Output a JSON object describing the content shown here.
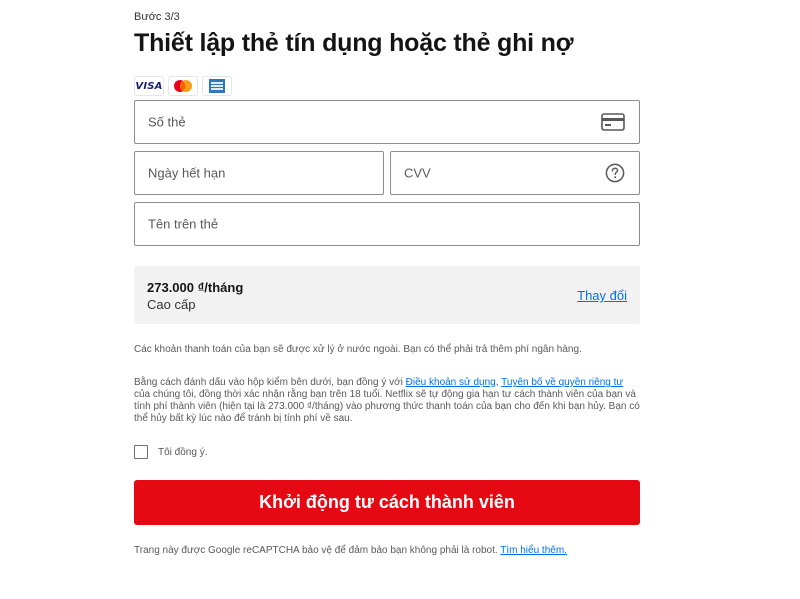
{
  "header": {
    "step": "Bước 3/3",
    "title": "Thiết lập thẻ tín dụng hoặc thẻ ghi nợ"
  },
  "card_logos": [
    "VISA",
    "Mastercard",
    "American Express"
  ],
  "form": {
    "card_number_label": "Số thẻ",
    "expiry_label": "Ngày hết hạn",
    "cvv_label": "CVV",
    "name_label": "Tên trên thẻ"
  },
  "plan": {
    "price": "273.000 ₫/tháng",
    "name": "Cao cấp",
    "change_link": "Thay đổi"
  },
  "notice": {
    "payment_note": "Các khoản thanh toán của bạn sẽ được xử lý ở nước ngoài. Bạn có thể phải trả thêm phí ngân hàng.",
    "terms_part1": "Bằng cách đánh dấu vào hộp kiểm bên dưới, bạn đồng ý với ",
    "terms_link": "Điều khoản sử dụng",
    "terms_sep": ", ",
    "privacy_link": "Tuyên bố về quyền riêng tư",
    "terms_part2": " của chúng tôi, đồng thời xác nhận rằng bạn trên 18 tuổi. Netflix sẽ tự động gia hạn tư cách thành viên của bạn và tính phí thành viên (hiện tại là 273.000 ₫/tháng) vào phương thức thanh toán của bạn cho đến khi bạn hủy. Bạn có thể hủy bất kỳ lúc nào để tránh bị tính phí về sau."
  },
  "agree": {
    "label": "Tôi đồng ý."
  },
  "cta": {
    "label": "Khởi động tư cách thành viên"
  },
  "recaptcha": {
    "text": "Trang này được Google reCAPTCHA bảo vệ để đảm bảo bạn không phải là robot. ",
    "link": "Tìm hiểu thêm."
  },
  "colors": {
    "brand_red": "#e50914",
    "link_blue": "#0071eb",
    "plan_bg": "#f2f2f2"
  },
  "icons": {
    "card_number": "credit-card-icon",
    "cvv": "question-circle-icon"
  }
}
